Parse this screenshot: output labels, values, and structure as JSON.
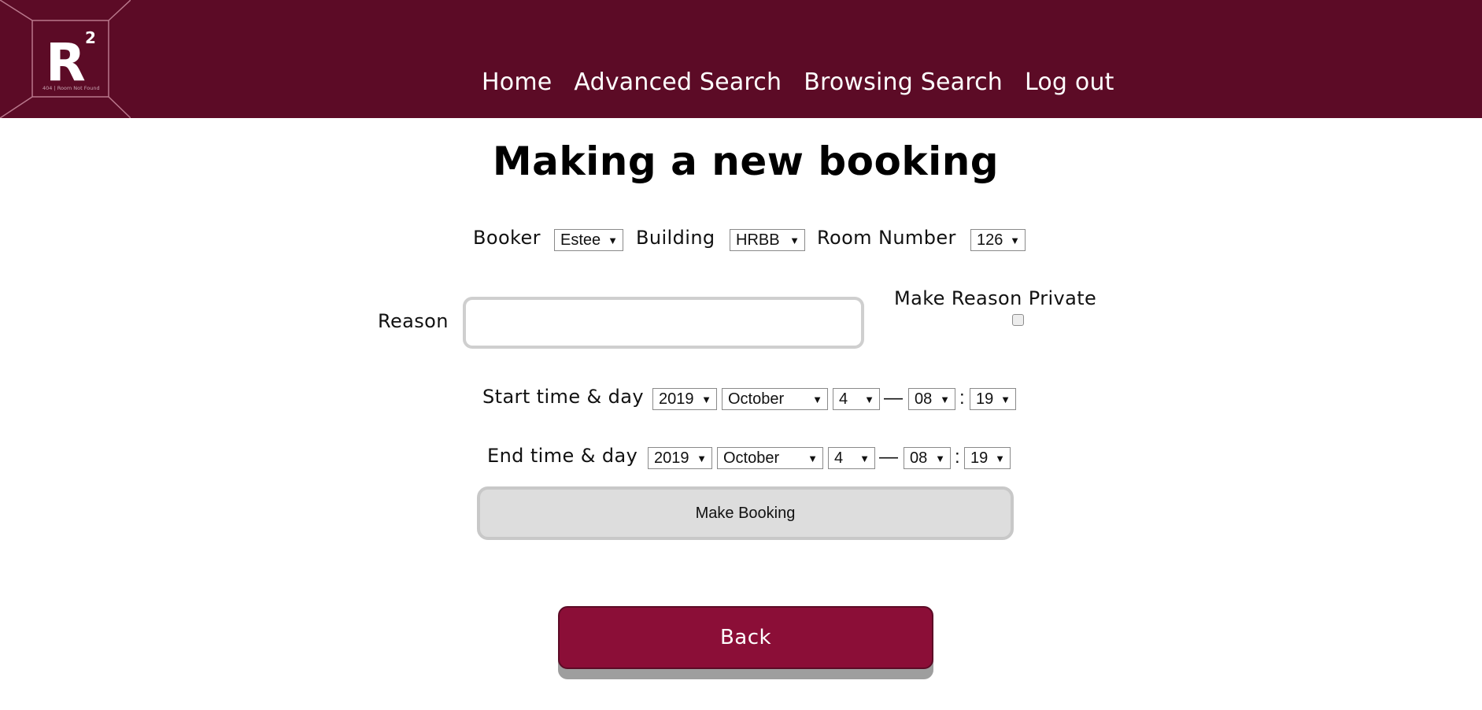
{
  "header": {
    "logo": {
      "letter": "R",
      "superscript": "2",
      "tagline": "404 | Room Not Found"
    },
    "nav": [
      {
        "label": "Home"
      },
      {
        "label": "Advanced Search"
      },
      {
        "label": "Browsing Search"
      },
      {
        "label": "Log out"
      }
    ]
  },
  "page": {
    "title": "Making a new booking"
  },
  "form": {
    "booker": {
      "label": "Booker",
      "value": "Estee"
    },
    "building": {
      "label": "Building",
      "value": "HRBB"
    },
    "room": {
      "label": "Room Number",
      "value": "126"
    },
    "reason": {
      "label": "Reason",
      "value": ""
    },
    "private": {
      "label": "Make Reason Private",
      "checked": false
    },
    "start": {
      "label": "Start time & day",
      "year": "2019",
      "month": "October",
      "day": "4",
      "hour": "08",
      "minute": "19"
    },
    "end": {
      "label": "End time & day",
      "year": "2019",
      "month": "October",
      "day": "4",
      "hour": "08",
      "minute": "19"
    },
    "separators": {
      "dash": "—",
      "colon": ":"
    },
    "submit_label": "Make Booking"
  },
  "back_label": "Back",
  "icons": {
    "dropdown": "dropdown-arrow-icon",
    "dropdown_glyph": "▼"
  },
  "colors": {
    "header_bg": "#5c0b26",
    "back_button": "#8b0e37",
    "make_booking_bg": "#dddddd"
  }
}
